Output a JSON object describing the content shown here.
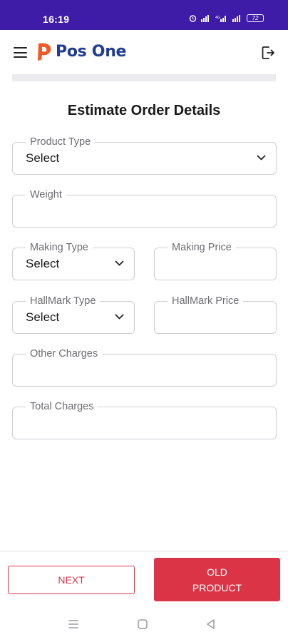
{
  "status_bar": {
    "time": "16:19",
    "icons": [
      "alarm-icon",
      "signal-icon",
      "wifi-signal-icon",
      "signal-icon",
      "battery-icon"
    ],
    "battery": "72"
  },
  "app_bar": {
    "logo_text": "Pos One",
    "brand_color": "#1f3d93",
    "logo_accent": "#f05a28"
  },
  "form": {
    "title": "Estimate Order Details",
    "fields": {
      "product_type": {
        "label": "Product Type",
        "value": "Select"
      },
      "weight": {
        "label": "Weight",
        "value": ""
      },
      "making_type": {
        "label": "Making Type",
        "value": "Select"
      },
      "making_price": {
        "label": "Making Price",
        "value": ""
      },
      "hallmark_type": {
        "label": "HallMark Type",
        "value": "Select"
      },
      "hallmark_price": {
        "label": "HallMark Price",
        "value": ""
      },
      "other_charges": {
        "label": "Other Charges",
        "value": ""
      },
      "total_charges": {
        "label": "Total Charges",
        "value": ""
      }
    }
  },
  "actions": {
    "next_label": "NEXT",
    "old_product_label": "OLD PRODUCT",
    "accent_color": "#dc3447"
  },
  "nav": {
    "icons": [
      "recent-apps-icon",
      "home-icon",
      "back-icon"
    ]
  }
}
